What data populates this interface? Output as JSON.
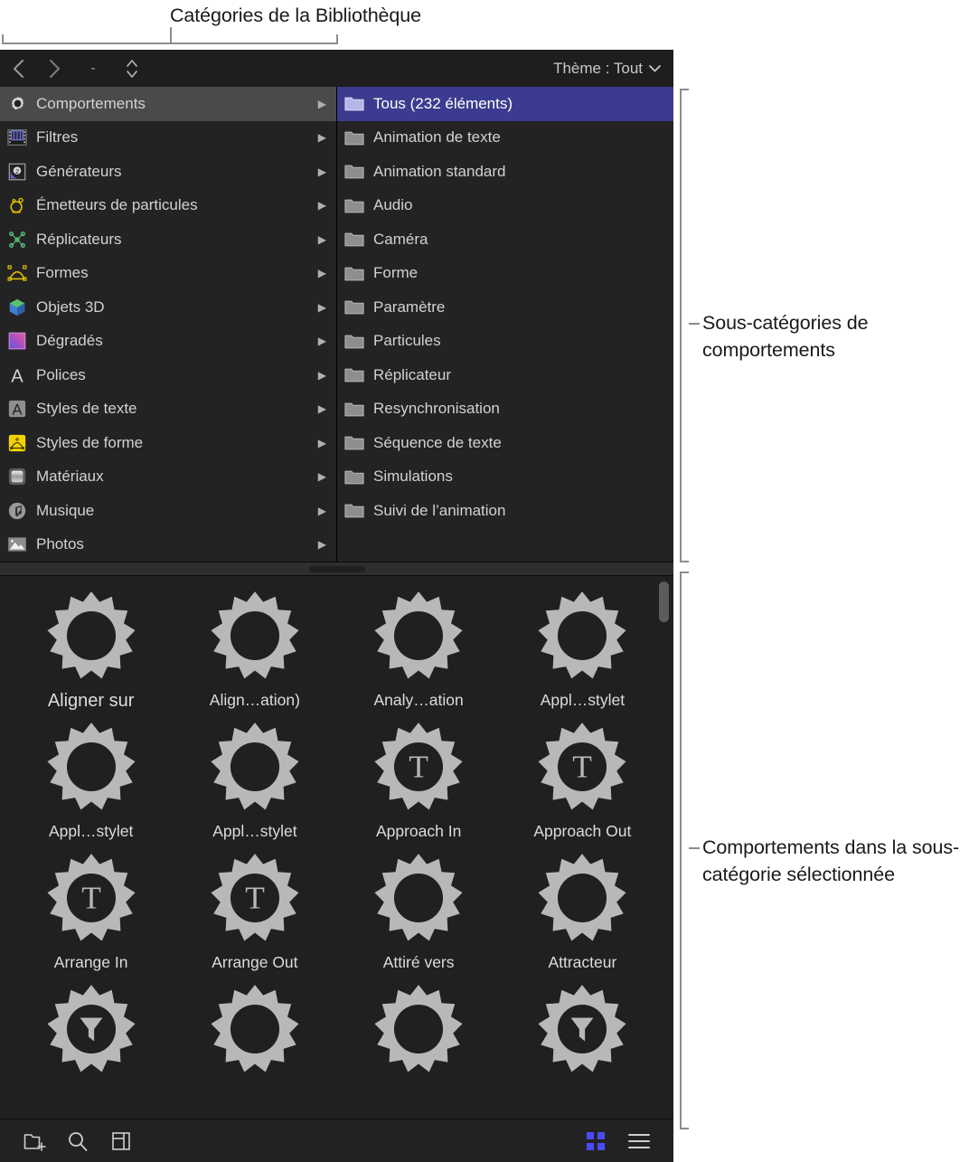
{
  "annotations": {
    "top": "Catégories de la Bibliothèque",
    "subcategories": "Sous-catégories de comportements",
    "behaviors": "Comportements dans la sous-catégorie sélectionnée"
  },
  "colors": {
    "selection_blue": "#3b3b8f",
    "selection_grey": "#4a4a4a",
    "accent_blue": "#4a4aff",
    "panel_bg": "#232323",
    "grid_bg": "#202020"
  },
  "toolbar": {
    "back_icon": "chevron-left-icon",
    "forward_icon": "chevron-right-icon",
    "path_label": "-",
    "stepper_icon": "up-down-arrows-icon",
    "theme_label": "Thème : Tout",
    "theme_chevron_icon": "chevron-down-icon"
  },
  "categories": [
    {
      "label": "Comportements",
      "icon": "gear-icon",
      "selected": true
    },
    {
      "label": "Filtres",
      "icon": "filmstrip-icon",
      "selected": false
    },
    {
      "label": "Générateurs",
      "icon": "generator-icon",
      "selected": false
    },
    {
      "label": "Émetteurs de particules",
      "icon": "particle-emitter-icon",
      "selected": false
    },
    {
      "label": "Réplicateurs",
      "icon": "replicator-icon",
      "selected": false
    },
    {
      "label": "Formes",
      "icon": "shape-icon",
      "selected": false
    },
    {
      "label": "Objets 3D",
      "icon": "cube-3d-icon",
      "selected": false
    },
    {
      "label": "Dégradés",
      "icon": "gradient-icon",
      "selected": false
    },
    {
      "label": "Polices",
      "icon": "font-a-icon",
      "selected": false
    },
    {
      "label": "Styles de texte",
      "icon": "text-style-icon",
      "selected": false
    },
    {
      "label": "Styles de forme",
      "icon": "shape-style-icon",
      "selected": false
    },
    {
      "label": "Matériaux",
      "icon": "material-icon",
      "selected": false
    },
    {
      "label": "Musique",
      "icon": "music-note-icon",
      "selected": false
    },
    {
      "label": "Photos",
      "icon": "photo-icon",
      "selected": false
    }
  ],
  "subcategories": [
    {
      "label": "Tous (232 éléments)",
      "icon": "folder-icon",
      "selected": true
    },
    {
      "label": "Animation de texte",
      "icon": "folder-icon",
      "selected": false
    },
    {
      "label": "Animation standard",
      "icon": "folder-icon",
      "selected": false
    },
    {
      "label": "Audio",
      "icon": "folder-icon",
      "selected": false
    },
    {
      "label": "Caméra",
      "icon": "folder-icon",
      "selected": false
    },
    {
      "label": "Forme",
      "icon": "folder-icon",
      "selected": false
    },
    {
      "label": "Paramètre",
      "icon": "folder-icon",
      "selected": false
    },
    {
      "label": "Particules",
      "icon": "folder-icon",
      "selected": false
    },
    {
      "label": "Réplicateur",
      "icon": "folder-icon",
      "selected": false
    },
    {
      "label": "Resynchronisation",
      "icon": "folder-icon",
      "selected": false
    },
    {
      "label": "Séquence de texte",
      "icon": "folder-icon",
      "selected": false
    },
    {
      "label": "Simulations",
      "icon": "folder-icon",
      "selected": false
    },
    {
      "label": "Suivi de l’animation",
      "icon": "folder-icon",
      "selected": false
    }
  ],
  "behaviors": [
    {
      "label": "Aligner sur",
      "icon": "gear-icon"
    },
    {
      "label": "Align…ation)",
      "icon": "gear-icon"
    },
    {
      "label": "Analy…ation",
      "icon": "gear-icon"
    },
    {
      "label": "Appl…stylet",
      "icon": "gear-icon"
    },
    {
      "label": "Appl…stylet",
      "icon": "gear-icon"
    },
    {
      "label": "Appl…stylet",
      "icon": "gear-icon"
    },
    {
      "label": "Approach In",
      "icon": "gear-text-icon"
    },
    {
      "label": "Approach Out",
      "icon": "gear-text-icon"
    },
    {
      "label": "Arrange In",
      "icon": "gear-text-icon"
    },
    {
      "label": "Arrange Out",
      "icon": "gear-text-icon"
    },
    {
      "label": "Attiré vers",
      "icon": "gear-icon"
    },
    {
      "label": "Attracteur",
      "icon": "gear-icon"
    },
    {
      "label": "",
      "icon": "gear-filter-icon"
    },
    {
      "label": "",
      "icon": "gear-icon"
    },
    {
      "label": "",
      "icon": "gear-icon"
    },
    {
      "label": "",
      "icon": "gear-filter-icon"
    }
  ],
  "footer": {
    "new_folder_icon": "new-folder-icon",
    "search_icon": "search-icon",
    "panel_icon": "panel-layout-icon",
    "grid_view_icon": "grid-view-icon",
    "list_view_icon": "list-view-icon"
  }
}
